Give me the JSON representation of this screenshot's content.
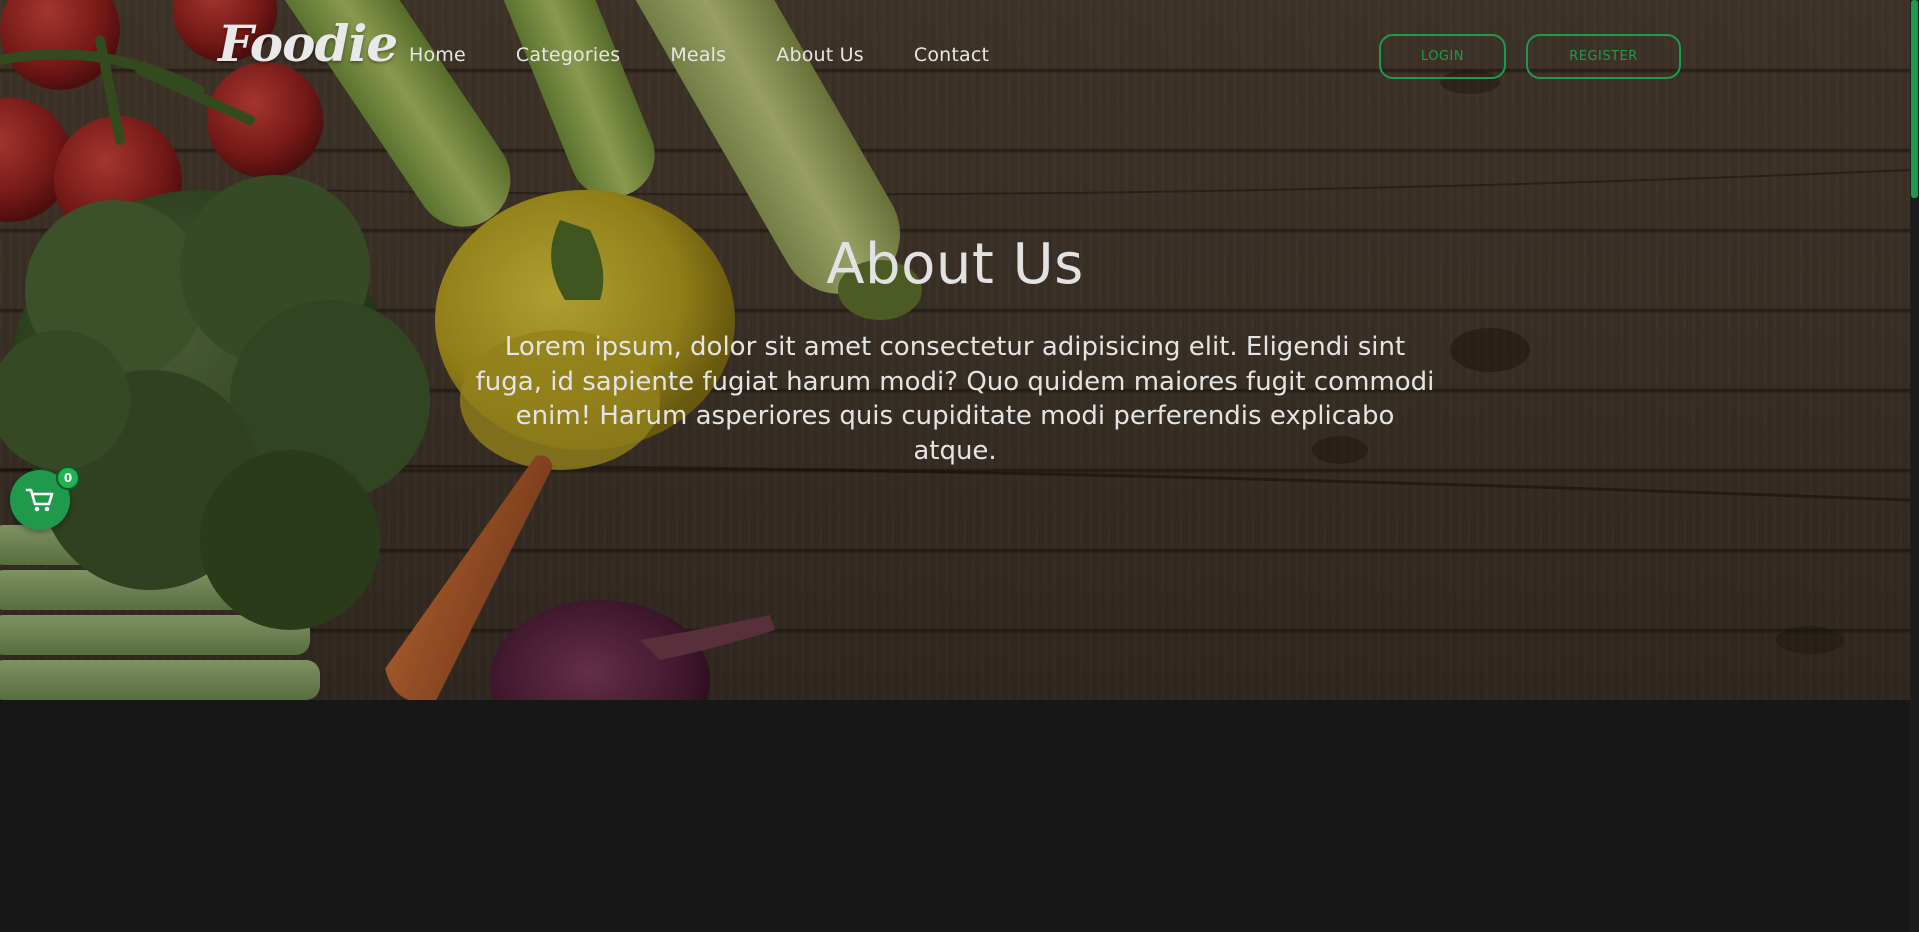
{
  "brand": {
    "logo_text": "Foodie"
  },
  "nav": {
    "items": [
      {
        "label": "Home"
      },
      {
        "label": "Categories"
      },
      {
        "label": "Meals"
      },
      {
        "label": "About Us"
      },
      {
        "label": "Contact"
      }
    ]
  },
  "auth": {
    "login_label": "LOGIN",
    "register_label": "REGISTER"
  },
  "hero": {
    "title": "About Us",
    "text": "Lorem ipsum, dolor sit amet consectetur adipisicing elit. Eligendi sint fuga, id sapiente fugiat harum modi? Quo quidem maiores fugit commodi enim! Harum asperiores quis cupiditate modi perferendis explicabo atque."
  },
  "cart": {
    "count": "0",
    "icon": "cart-icon"
  },
  "colors": {
    "accent": "#1f9a4c",
    "background": "#171717",
    "text": "#e6e6e6"
  }
}
